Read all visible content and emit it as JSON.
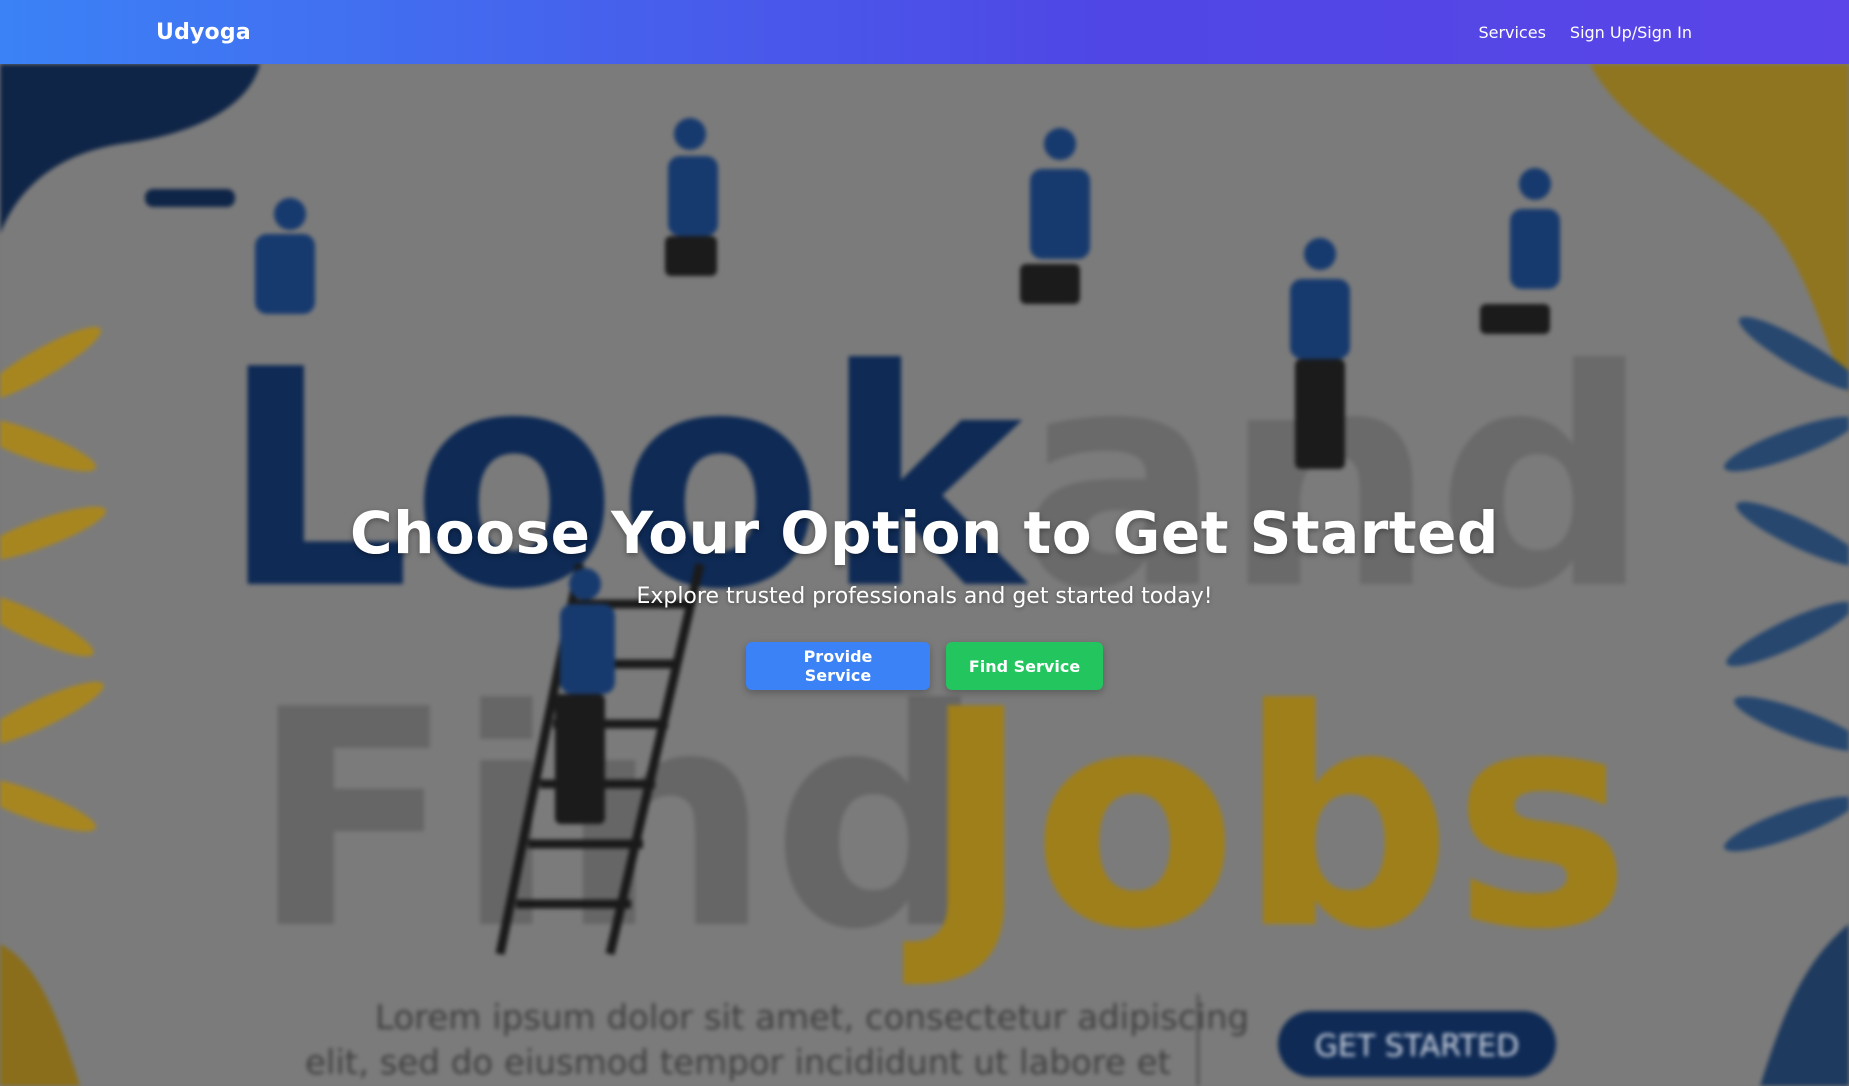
{
  "navbar": {
    "brand": "Udyoga",
    "links": [
      {
        "label": "Services"
      },
      {
        "label": "Sign Up/Sign In"
      }
    ],
    "gradient_start": "#3b82f6",
    "gradient_end": "#5b45e8"
  },
  "hero": {
    "title": "Choose Your Option to Get Started",
    "subtitle": "Explore trusted professionals and get started today!",
    "buttons": {
      "provide_label": "Provide Service",
      "find_label": "Find Service"
    },
    "colors": {
      "provide": "#3b82f6",
      "find": "#22c55e"
    },
    "background_art": {
      "words_line1": [
        "Look",
        "and"
      ],
      "words_line2": [
        "Find",
        "Jobs"
      ],
      "lorem_line1": "Lorem ipsum dolor sit amet, consectetur adipiscing",
      "lorem_line2": "elit, sed do eiusmod tempor incididunt ut labore et",
      "cta": "GET STARTED"
    }
  }
}
